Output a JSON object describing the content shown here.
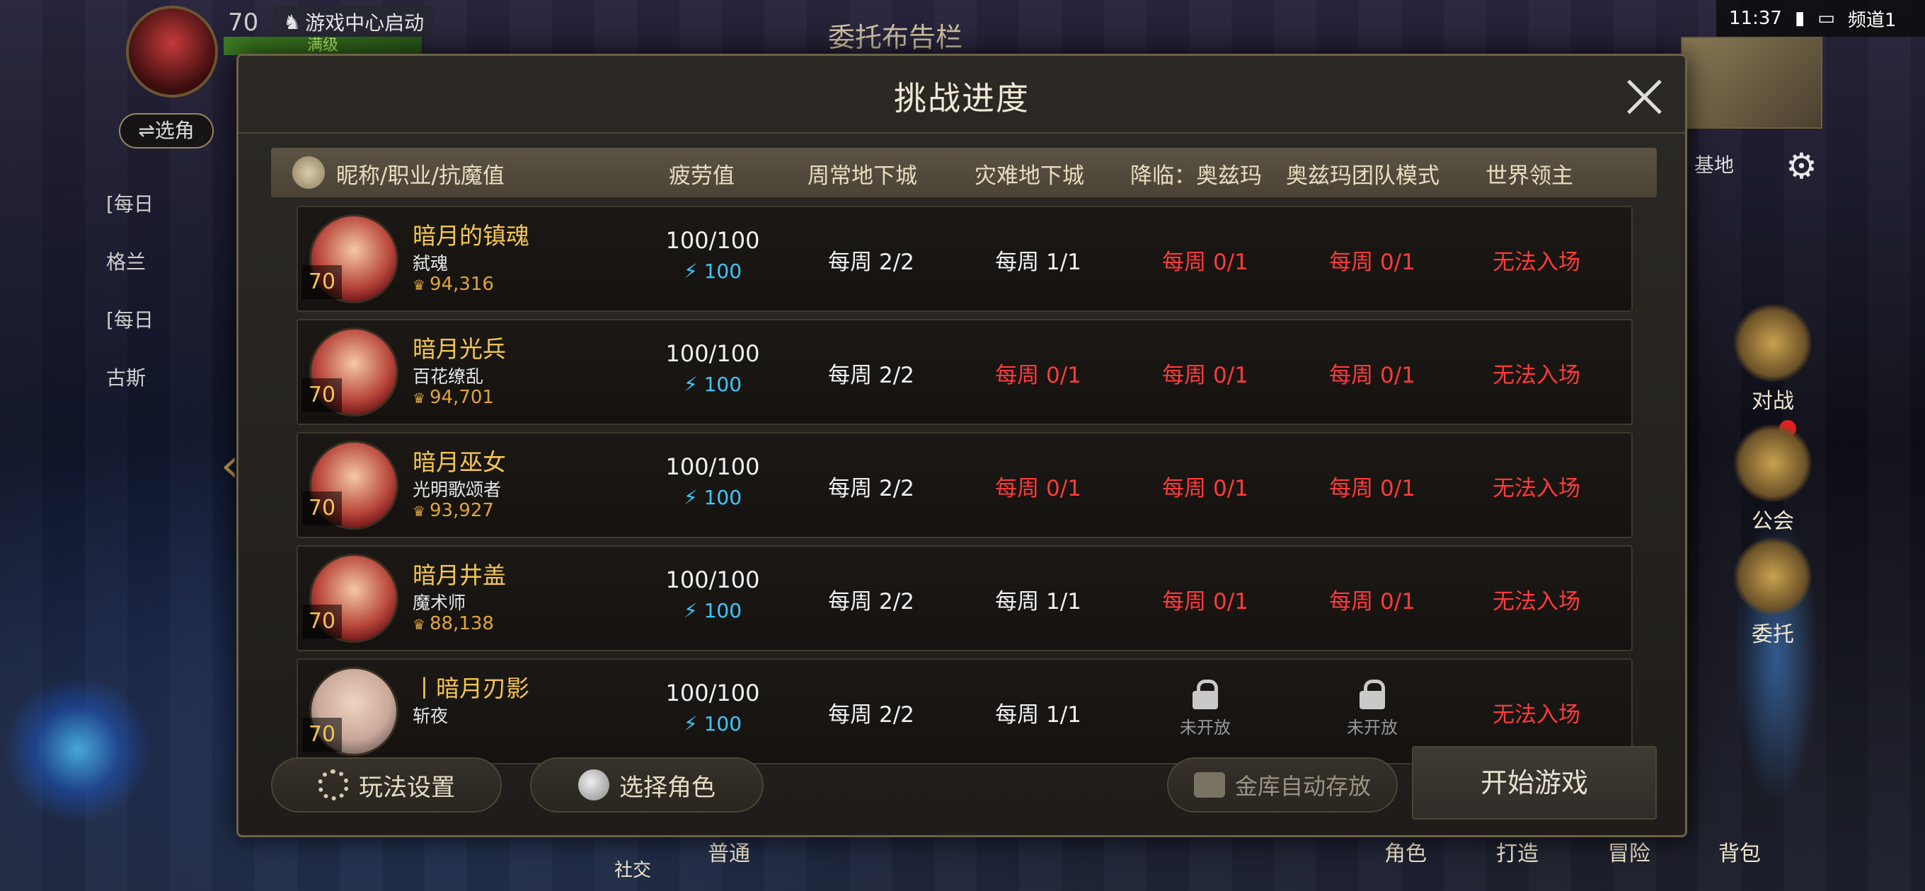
{
  "hud": {
    "level": "70",
    "launch_label": "游戏中心启动",
    "max_level_label": "满级",
    "switch_role_label": "⇌选角",
    "title": "委托布告栏",
    "quests": [
      "[每日",
      "格兰",
      "[每日",
      "古斯"
    ]
  },
  "status_bar": {
    "time": "11:37",
    "channel": "频道1"
  },
  "right_menu": {
    "base_label": "基地",
    "items": [
      "对战",
      "公会",
      "委托"
    ]
  },
  "bottom_bar": {
    "items": [
      "社交",
      "普通",
      "角色",
      "打造",
      "冒险",
      "背包"
    ]
  },
  "dialog": {
    "title": "挑战进度",
    "columns": {
      "name": "昵称/职业/抗魔值",
      "fatigue": "疲劳值",
      "normal": "周常地下城",
      "disaster": "灾难地下城",
      "descent": "降临：奥兹玛",
      "raid": "奥兹玛团队模式",
      "boss": "世界领主"
    },
    "rows": [
      {
        "level": "70",
        "name": "暗月的镇魂",
        "job": "弑魂",
        "power": "94,316",
        "fatigue": "100/100",
        "fatigue_sub": "100",
        "normal": "每周 2/2",
        "disaster": "每周 1/1",
        "descent": "每周 0/1",
        "raid": "每周 0/1",
        "boss": "无法入场"
      },
      {
        "level": "70",
        "name": "暗月光兵",
        "job": "百花缭乱",
        "power": "94,701",
        "fatigue": "100/100",
        "fatigue_sub": "100",
        "normal": "每周 2/2",
        "disaster": "每周 0/1",
        "descent": "每周 0/1",
        "raid": "每周 0/1",
        "boss": "无法入场"
      },
      {
        "level": "70",
        "name": "暗月巫女",
        "job": "光明歌颂者",
        "power": "93,927",
        "fatigue": "100/100",
        "fatigue_sub": "100",
        "normal": "每周 2/2",
        "disaster": "每周 0/1",
        "descent": "每周 0/1",
        "raid": "每周 0/1",
        "boss": "无法入场"
      },
      {
        "level": "70",
        "name": "暗月井盖",
        "job": "魔术师",
        "power": "88,138",
        "fatigue": "100/100",
        "fatigue_sub": "100",
        "normal": "每周 2/2",
        "disaster": "每周 1/1",
        "descent": "每周 0/1",
        "raid": "每周 0/1",
        "boss": "无法入场"
      },
      {
        "level": "70",
        "name": "丨暗月刃影",
        "job": "斩夜",
        "power": "",
        "fatigue": "100/100",
        "fatigue_sub": "100",
        "normal": "每周 2/2",
        "disaster": "每周 1/1",
        "descent_locked": "未开放",
        "raid_locked": "未开放",
        "boss": "无法入场"
      }
    ],
    "buttons": {
      "settings": "玩法设置",
      "select_role": "选择角色",
      "vault_auto": "金库自动存放",
      "start": "开始游戏"
    }
  },
  "colors": {
    "gold": "#f3c553",
    "red": "#ff3b3b",
    "cyan": "#3cc8ff"
  }
}
